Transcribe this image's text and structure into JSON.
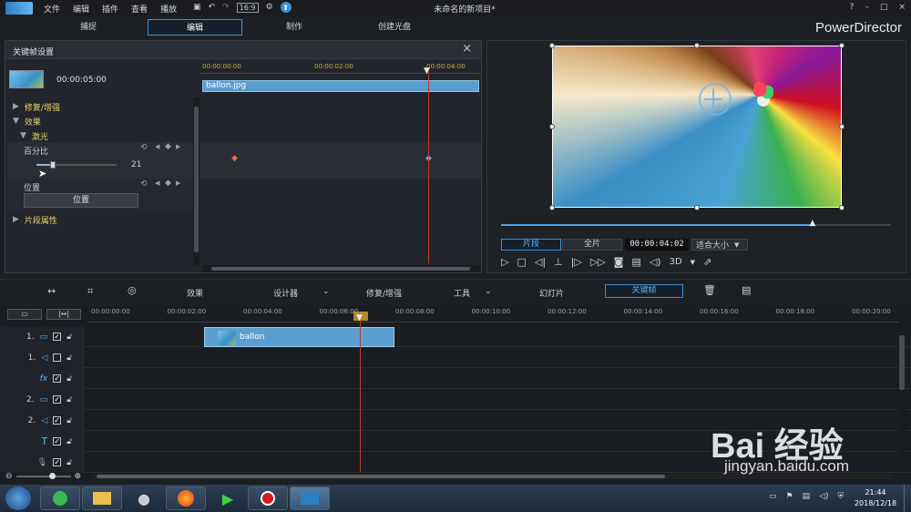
{
  "app": {
    "title": "未命名的新项目*",
    "brand": "PowerDirector"
  },
  "menu": [
    "文件",
    "编辑",
    "插件",
    "查看",
    "播放"
  ],
  "win_controls": [
    "?",
    "–",
    "□",
    "×"
  ],
  "tabs": [
    {
      "label": "捕捉"
    },
    {
      "label": "编辑",
      "active": true
    },
    {
      "label": "制作"
    },
    {
      "label": "创建光盘"
    }
  ],
  "kf_panel": {
    "title": "关键帧设置",
    "clip_duration": "00:00:05:00",
    "ruler": [
      "00:00:00:00",
      "00:00:02:00",
      "00:00:04:00"
    ],
    "clip_name": "ballon.jpg",
    "tree": {
      "fix": "修复/增强",
      "effects": "效果",
      "laser": "激光",
      "percent": "百分比",
      "percent_value": "21",
      "percent_fraction": 0.21,
      "position": "位置",
      "position_button": "位置",
      "clip_props": "片段属性"
    }
  },
  "preview": {
    "mode_clip": "片段",
    "mode_movie": "全片",
    "timecode": "00:00:04:02",
    "fit": "适合大小",
    "view_3d": "3D",
    "progress": 0.8
  },
  "toolbar": {
    "effects": "效果",
    "designer": "设计器",
    "fix": "修复/增强",
    "tools": "工具",
    "slideshow": "幻灯片",
    "keyframe": "关键帧"
  },
  "timeline": {
    "ruler": [
      "00:00:00:00",
      "00:00:02:00",
      "00:00:04:00",
      "00:00:06:00",
      "00:00:08:00",
      "00:00:10:00",
      "00:00:12:00",
      "00:00:14:00",
      "00:00:16:00",
      "00:00:18:00",
      "00:00:20:00"
    ],
    "clip_label": "ballon",
    "tracks": [
      {
        "num": "1.",
        "type": "video",
        "checked": true
      },
      {
        "num": "1.",
        "type": "audio",
        "checked": false
      },
      {
        "num": "",
        "type": "fx",
        "checked": true
      },
      {
        "num": "2.",
        "type": "video",
        "checked": true
      },
      {
        "num": "2.",
        "type": "audio",
        "checked": true
      },
      {
        "num": "",
        "type": "text",
        "checked": true
      },
      {
        "num": "",
        "type": "voice",
        "checked": true
      }
    ]
  },
  "taskbar": {
    "time": "21:44",
    "date": "2018/12/18"
  },
  "watermark": {
    "text": "Bai 经验",
    "url": "jingyan.baidu.com"
  },
  "colors": {
    "accent": "#3d8fd8",
    "clip": "#5b9fd0",
    "playhead": "#c0392b"
  }
}
